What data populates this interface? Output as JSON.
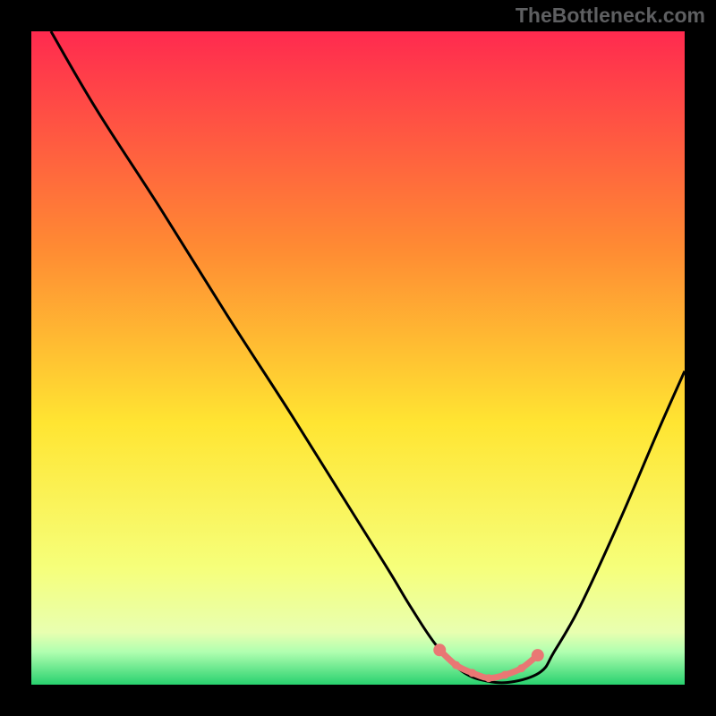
{
  "attribution": "TheBottleneck.com",
  "colors": {
    "top": "#ff2a4f",
    "mid_upper": "#ff8a33",
    "mid": "#ffe532",
    "lower": "#f6ff7a",
    "bottom_band": "#b6ffb0",
    "bottom": "#28d16e",
    "line": "#000000",
    "marker": "#e97774",
    "marker_line": "#c9504f"
  },
  "chart_data": {
    "type": "line",
    "title": "",
    "xlabel": "",
    "ylabel": "",
    "xlim": [
      0,
      100
    ],
    "ylim": [
      0,
      100
    ],
    "series": [
      {
        "name": "curve",
        "x": [
          3,
          10,
          20,
          30,
          40,
          50,
          55,
          58,
          62,
          66,
          70,
          74,
          78,
          80,
          84,
          90,
          96,
          100
        ],
        "y": [
          100,
          88,
          72.5,
          56.5,
          41,
          25,
          17,
          12,
          6,
          2,
          0.5,
          0.5,
          2,
          5,
          12,
          25,
          39,
          48
        ]
      }
    ],
    "markers": {
      "x": [
        62.5,
        65,
        67.5,
        70,
        72.5,
        75,
        77.5
      ],
      "y": [
        5.3,
        3.0,
        1.8,
        1.0,
        1.5,
        2.5,
        4.5
      ]
    },
    "gradient_stops": [
      {
        "offset": 0,
        "color": "#ff2a4f"
      },
      {
        "offset": 33,
        "color": "#ff8a33"
      },
      {
        "offset": 60,
        "color": "#ffe532"
      },
      {
        "offset": 82,
        "color": "#f6ff7a"
      },
      {
        "offset": 92,
        "color": "#e8ffb0"
      },
      {
        "offset": 95,
        "color": "#b0ffb0"
      },
      {
        "offset": 100,
        "color": "#28d16e"
      }
    ]
  }
}
